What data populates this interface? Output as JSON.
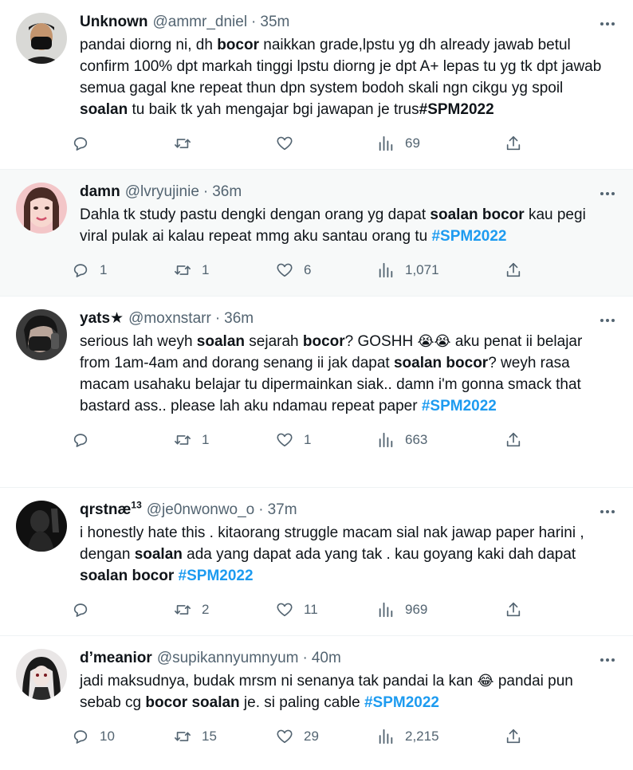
{
  "tweets": [
    {
      "name": "Unknown",
      "handle": "@ammr_dniel",
      "time": "35m",
      "segments": [
        {
          "t": "pandai diorng ni, dh "
        },
        {
          "t": "bocor",
          "b": true
        },
        {
          "t": " naikkan grade,lpstu yg dh already jawab betul confirm 100% dpt markah tinggi lpstu diorng je dpt A+ lepas tu yg tk dpt jawab semua gagal kne repeat thun dpn system bodoh skali ngn cikgu yg spoil "
        },
        {
          "t": "soalan",
          "b": true
        },
        {
          "t": " tu baik tk yah mengajar bgi jawapan je trus"
        },
        {
          "t": "#SPM2022",
          "b": true
        }
      ],
      "replies": "",
      "retweets": "",
      "likes": "",
      "views": "69"
    },
    {
      "name": "damn",
      "handle": "@lvryujinie",
      "time": "36m",
      "segments": [
        {
          "t": "Dahla tk study pastu dengki dengan orang yg dapat "
        },
        {
          "t": "soalan bocor",
          "b": true
        },
        {
          "t": " kau pegi viral pulak ai kalau repeat mmg aku santau orang tu "
        },
        {
          "t": "#SPM2022",
          "tag": true
        }
      ],
      "replies": "1",
      "retweets": "1",
      "likes": "6",
      "views": "1,071"
    },
    {
      "name": "yats★",
      "handle": "@moxnstarr",
      "time": "36m",
      "segments": [
        {
          "t": "serious lah weyh "
        },
        {
          "t": "soalan",
          "b": true
        },
        {
          "t": " sejarah "
        },
        {
          "t": "bocor",
          "b": true
        },
        {
          "t": "? GOSHH "
        },
        {
          "t": "😭😭",
          "emoji": true
        },
        {
          "t": " aku penat ii belajar from 1am-4am and dorang senang ii jak dapat "
        },
        {
          "t": "soalan bocor",
          "b": true
        },
        {
          "t": "? weyh rasa macam usahaku belajar tu dipermainkan siak.. damn i'm gonna smack that bastard ass.. please lah aku ndamau repeat paper "
        },
        {
          "t": "#SPM2022",
          "tag": true
        }
      ],
      "replies": "",
      "retweets": "1",
      "likes": "1",
      "views": "663"
    },
    {
      "name": "qrstnæ",
      "name_sup": "13",
      "handle": "@je0nwonwo_o",
      "time": "37m",
      "segments": [
        {
          "t": "i honestly hate this . kitaorang struggle macam sial nak jawap paper harini , dengan "
        },
        {
          "t": "soalan",
          "b": true
        },
        {
          "t": " ada yang dapat ada yang tak . kau goyang kaki dah dapat "
        },
        {
          "t": "soalan bocor",
          "b": true
        },
        {
          "t": " "
        },
        {
          "t": "#SPM2022",
          "tag": true
        }
      ],
      "replies": "",
      "retweets": "2",
      "likes": "11",
      "views": "969"
    },
    {
      "name": "d’meanior",
      "handle": "@supikannyumnyum",
      "time": "40m",
      "segments": [
        {
          "t": "jadi maksudnya, budak mrsm ni senanya tak pandai la kan "
        },
        {
          "t": "😂",
          "emoji": true
        },
        {
          "t": " pandai pun sebab cg "
        },
        {
          "t": "bocor soalan",
          "b": true
        },
        {
          "t": " je. si paling cable "
        },
        {
          "t": "#SPM2022",
          "tag": true
        }
      ],
      "replies": "10",
      "retweets": "15",
      "likes": "29",
      "views": "2,215"
    }
  ],
  "icons": {
    "reply": "reply-icon",
    "retweet": "retweet-icon",
    "like": "heart-icon",
    "views": "views-icon",
    "share": "share-icon",
    "more": "more-icon"
  },
  "colors": {
    "text": "#0f1419",
    "secondary": "#536471",
    "hashtag": "#1d9bf0",
    "highlight_bg": "#f7f9f9"
  }
}
